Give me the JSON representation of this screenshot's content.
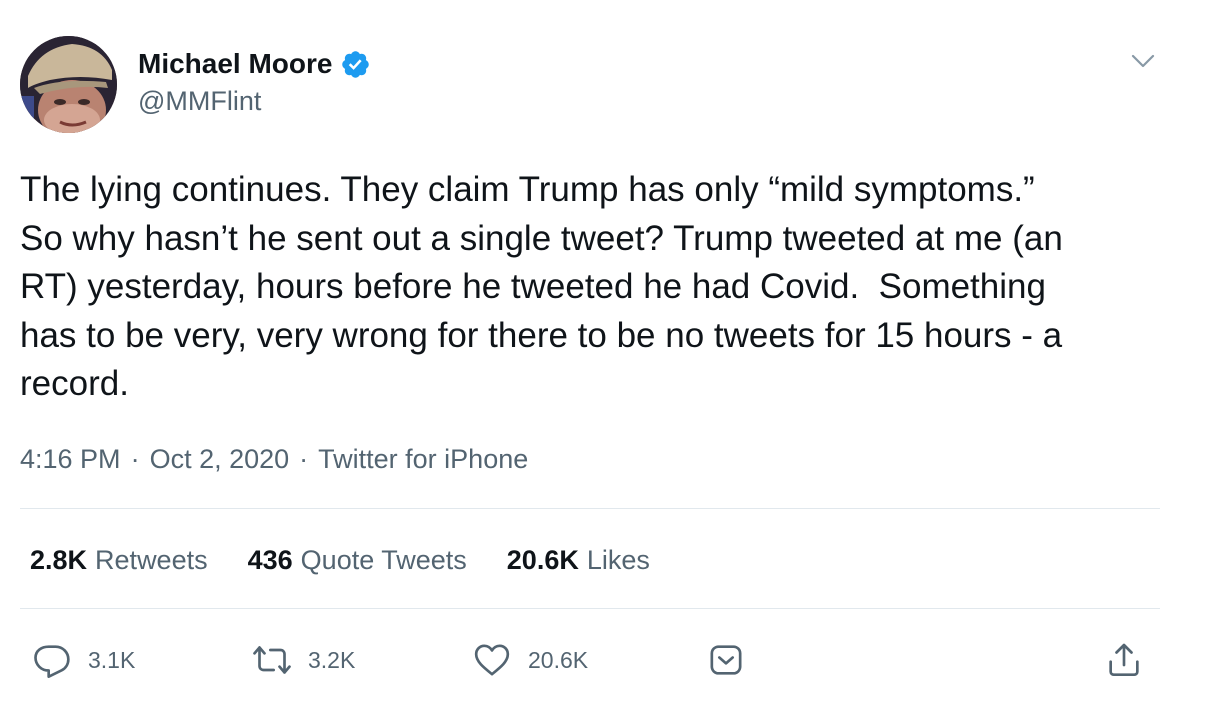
{
  "author": {
    "display_name": "Michael Moore",
    "handle": "@MMFlint",
    "verified": true,
    "verified_color": "#1d9bf0"
  },
  "tweet": {
    "text": "The lying continues. They claim Trump has only “mild symptoms.”\nSo why hasn’t he sent out a single tweet? Trump tweeted at me (an\nRT) yesterday, hours before he tweeted he had Covid.  Something\nhas to be very, very wrong for there to be no tweets for 15 hours - a\nrecord.",
    "time": "4:16 PM",
    "date": "Oct 2, 2020",
    "source": "Twitter for iPhone",
    "separator": "·"
  },
  "stats": {
    "retweets": {
      "count": "2.8K",
      "label": "Retweets"
    },
    "quote_tweets": {
      "count": "436",
      "label": "Quote Tweets"
    },
    "likes": {
      "count": "20.6K",
      "label": "Likes"
    }
  },
  "actions": {
    "reply": {
      "icon": "reply-icon",
      "count": "3.1K"
    },
    "retweet": {
      "icon": "retweet-icon",
      "count": "3.2K"
    },
    "like": {
      "icon": "heart-icon",
      "count": "20.6K"
    },
    "save": {
      "icon": "save-icon"
    },
    "share": {
      "icon": "share-icon"
    }
  },
  "colors": {
    "text_primary": "#0f1419",
    "text_secondary": "#536471",
    "divider": "#e1e8ed",
    "icon": "#536471"
  }
}
